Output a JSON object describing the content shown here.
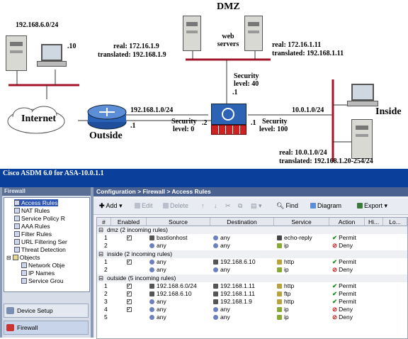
{
  "diagram": {
    "dmz_label": "DMZ",
    "net_top_left": "192.168.6.0/24",
    "host_dot10": ".10",
    "web_servers": "web\nservers",
    "real_left": "real: 172.16.1.9",
    "translated_left": "translated: 192.168.1.9",
    "real_right": "real: 172.16.1.11",
    "translated_right": "translated: 192.168.1.11",
    "security_dmz_1": "Security",
    "security_dmz_2": "level: 40",
    "dmz_dot1": ".1",
    "internet_label": "Internet",
    "outside_net": "192.168.1.0/24",
    "outside_dot1": ".1",
    "outside_label": "Outside",
    "security_out_1": "Security",
    "security_out_2": "level: 0",
    "outside_dot2": ".2",
    "inside_net": "10.0.1.0/24",
    "inside_label": "Inside",
    "security_in_1": "Security",
    "security_in_2": "level: 100",
    "inside_dot1": ".1",
    "real_inside": "real: 10.0.1.0/24",
    "translated_inside": "translated: 192.168.1.20-254/24"
  },
  "window_title": "Cisco ASDM 6.0 for ASA-10.0.1.1",
  "left": {
    "header": "Firewall",
    "tree": [
      "Access Rules",
      "NAT Rules",
      "Service Policy R",
      "AAA Rules",
      "Filter Rules",
      "URL Filtering Ser",
      "Threat Detection",
      "Objects",
      "Network Obje",
      "IP Names",
      "Service Grou"
    ],
    "nav": [
      "Device Setup",
      "Firewall"
    ]
  },
  "breadcrumb": "Configuration > Firewall > Access Rules",
  "toolbar": {
    "add": "Add",
    "edit": "Edit",
    "delete": "Delete",
    "find": "Find",
    "diagram": "Diagram",
    "export": "Export"
  },
  "columns": [
    "#",
    "Enabled",
    "Source",
    "Destination",
    "Service",
    "Action",
    "Hi...",
    "Lo..."
  ],
  "groups": [
    {
      "label": "dmz (2 incoming rules)",
      "rules": [
        {
          "num": "1",
          "enabled": true,
          "source": "bastionhost",
          "destination": "any",
          "service": "echo-reply",
          "action": "Permit"
        },
        {
          "num": "2",
          "enabled": false,
          "source": "any",
          "destination": "any",
          "service": "ip",
          "action": "Deny"
        }
      ]
    },
    {
      "label": "inside (2 incoming rules)",
      "rules": [
        {
          "num": "1",
          "enabled": true,
          "source": "any",
          "destination": "192.168.6.10",
          "service": "http",
          "action": "Permit"
        },
        {
          "num": "2",
          "enabled": false,
          "source": "any",
          "destination": "any",
          "service": "ip",
          "action": "Deny"
        }
      ]
    },
    {
      "label": "outside (5 incoming rules)",
      "rules": [
        {
          "num": "1",
          "enabled": true,
          "source": "192.168.6.0/24",
          "destination": "192.168.1.11",
          "service": "http",
          "action": "Permit"
        },
        {
          "num": "2",
          "enabled": true,
          "source": "192.168.6.10",
          "destination": "192.168.1.11",
          "service": "ftp",
          "action": "Permit"
        },
        {
          "num": "3",
          "enabled": true,
          "source": "any",
          "destination": "192.168.1.9",
          "service": "http",
          "action": "Permit"
        },
        {
          "num": "4",
          "enabled": true,
          "source": "any",
          "destination": "any",
          "service": "ip",
          "action": "Deny"
        },
        {
          "num": "5",
          "enabled": false,
          "source": "any",
          "destination": "any",
          "service": "ip",
          "action": "Deny"
        }
      ]
    }
  ]
}
